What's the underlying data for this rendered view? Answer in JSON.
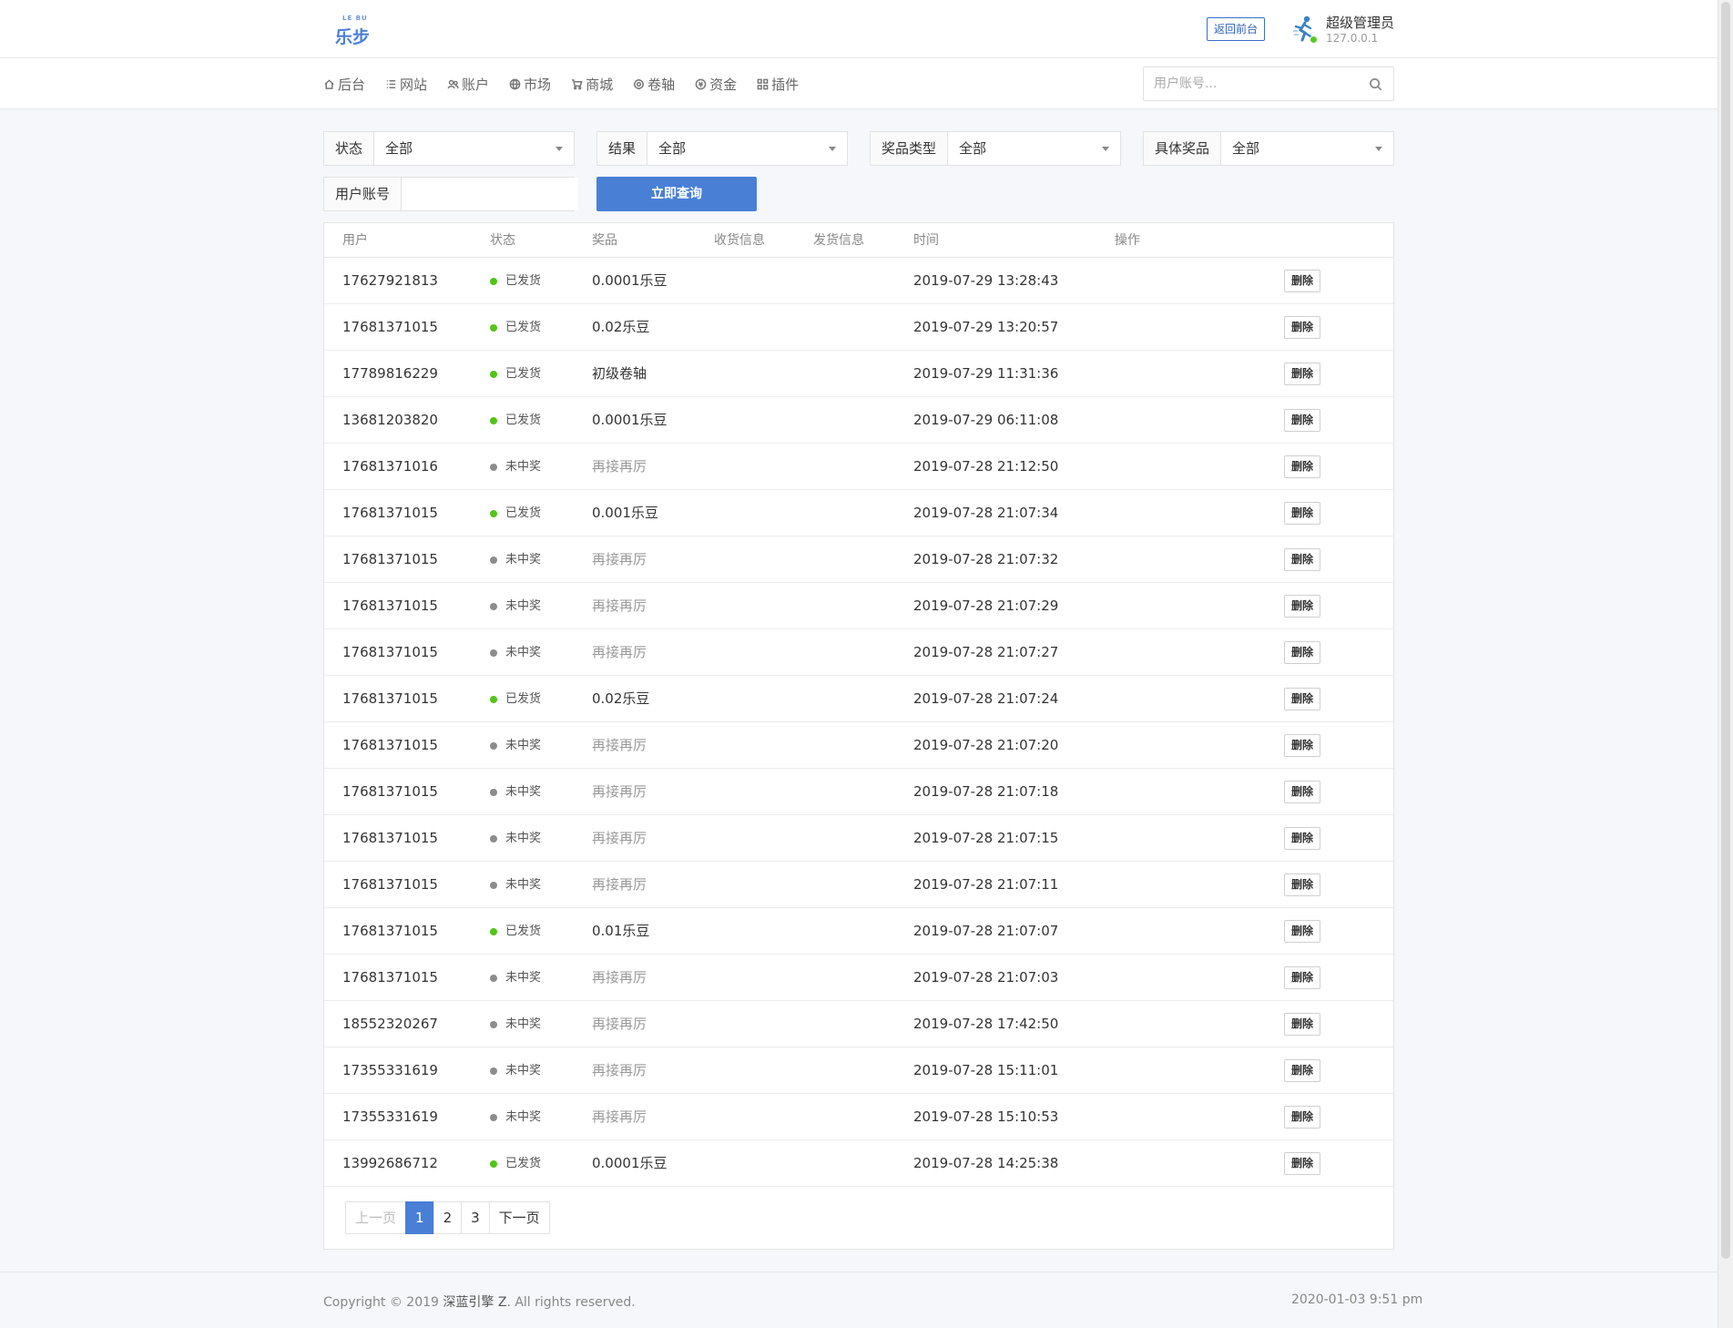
{
  "header": {
    "logo_sub": "LE BU",
    "logo_main": "乐步",
    "back_label": "返回前台",
    "user_name": "超级管理员",
    "user_ip": "127.0.0.1"
  },
  "nav": {
    "items": [
      {
        "label": "后台",
        "icon": "home-icon"
      },
      {
        "label": "网站",
        "icon": "list-icon"
      },
      {
        "label": "账户",
        "icon": "users-icon"
      },
      {
        "label": "市场",
        "icon": "globe-icon"
      },
      {
        "label": "商城",
        "icon": "cart-icon"
      },
      {
        "label": "卷轴",
        "icon": "gear-icon"
      },
      {
        "label": "资金",
        "icon": "coin-icon"
      },
      {
        "label": "插件",
        "icon": "grid-icon"
      }
    ],
    "search_placeholder": "用户账号..."
  },
  "filters": {
    "status_label": "状态",
    "status_value": "全部",
    "result_label": "结果",
    "result_value": "全部",
    "prize_type_label": "奖品类型",
    "prize_type_value": "全部",
    "prize_label": "具体奖品",
    "prize_value": "全部",
    "account_label": "用户账号",
    "account_value": "",
    "query_label": "立即查询"
  },
  "table": {
    "headers": [
      "用户",
      "状态",
      "奖品",
      "收货信息",
      "发货信息",
      "时间",
      "操作"
    ],
    "delete_label": "删除",
    "colors": {
      "shipped": "#52c41a",
      "lost": "#8c8c8c"
    },
    "rows": [
      {
        "user": "17627921813",
        "status": "已发货",
        "prize": "0.0001乐豆",
        "receipt": "",
        "shipping": "",
        "time": "2019-07-29 13:28:43"
      },
      {
        "user": "17681371015",
        "status": "已发货",
        "prize": "0.02乐豆",
        "receipt": "",
        "shipping": "",
        "time": "2019-07-29 13:20:57"
      },
      {
        "user": "17789816229",
        "status": "已发货",
        "prize": "初级卷轴",
        "receipt": "",
        "shipping": "",
        "time": "2019-07-29 11:31:36"
      },
      {
        "user": "13681203820",
        "status": "已发货",
        "prize": "0.0001乐豆",
        "receipt": "",
        "shipping": "",
        "time": "2019-07-29 06:11:08"
      },
      {
        "user": "17681371016",
        "status": "未中奖",
        "prize": "再接再厉",
        "receipt": "",
        "shipping": "",
        "time": "2019-07-28 21:12:50"
      },
      {
        "user": "17681371015",
        "status": "已发货",
        "prize": "0.001乐豆",
        "receipt": "",
        "shipping": "",
        "time": "2019-07-28 21:07:34"
      },
      {
        "user": "17681371015",
        "status": "未中奖",
        "prize": "再接再厉",
        "receipt": "",
        "shipping": "",
        "time": "2019-07-28 21:07:32"
      },
      {
        "user": "17681371015",
        "status": "未中奖",
        "prize": "再接再厉",
        "receipt": "",
        "shipping": "",
        "time": "2019-07-28 21:07:29"
      },
      {
        "user": "17681371015",
        "status": "未中奖",
        "prize": "再接再厉",
        "receipt": "",
        "shipping": "",
        "time": "2019-07-28 21:07:27"
      },
      {
        "user": "17681371015",
        "status": "已发货",
        "prize": "0.02乐豆",
        "receipt": "",
        "shipping": "",
        "time": "2019-07-28 21:07:24"
      },
      {
        "user": "17681371015",
        "status": "未中奖",
        "prize": "再接再厉",
        "receipt": "",
        "shipping": "",
        "time": "2019-07-28 21:07:20"
      },
      {
        "user": "17681371015",
        "status": "未中奖",
        "prize": "再接再厉",
        "receipt": "",
        "shipping": "",
        "time": "2019-07-28 21:07:18"
      },
      {
        "user": "17681371015",
        "status": "未中奖",
        "prize": "再接再厉",
        "receipt": "",
        "shipping": "",
        "time": "2019-07-28 21:07:15"
      },
      {
        "user": "17681371015",
        "status": "未中奖",
        "prize": "再接再厉",
        "receipt": "",
        "shipping": "",
        "time": "2019-07-28 21:07:11"
      },
      {
        "user": "17681371015",
        "status": "已发货",
        "prize": "0.01乐豆",
        "receipt": "",
        "shipping": "",
        "time": "2019-07-28 21:07:07"
      },
      {
        "user": "17681371015",
        "status": "未中奖",
        "prize": "再接再厉",
        "receipt": "",
        "shipping": "",
        "time": "2019-07-28 21:07:03"
      },
      {
        "user": "18552320267",
        "status": "未中奖",
        "prize": "再接再厉",
        "receipt": "",
        "shipping": "",
        "time": "2019-07-28 17:42:50"
      },
      {
        "user": "17355331619",
        "status": "未中奖",
        "prize": "再接再厉",
        "receipt": "",
        "shipping": "",
        "time": "2019-07-28 15:11:01"
      },
      {
        "user": "17355331619",
        "status": "未中奖",
        "prize": "再接再厉",
        "receipt": "",
        "shipping": "",
        "time": "2019-07-28 15:10:53"
      },
      {
        "user": "13992686712",
        "status": "已发货",
        "prize": "0.0001乐豆",
        "receipt": "",
        "shipping": "",
        "time": "2019-07-28 14:25:38"
      }
    ]
  },
  "pagination": {
    "prev": "上一页",
    "pages": [
      "1",
      "2",
      "3"
    ],
    "current": "1",
    "next": "下一页"
  },
  "footer": {
    "copyright_prefix": "Copyright © 2019 ",
    "company": "深蓝引擎 Z",
    "copyright_suffix": ". All rights reserved.",
    "datetime": "2020-01-03 9:51 pm"
  }
}
